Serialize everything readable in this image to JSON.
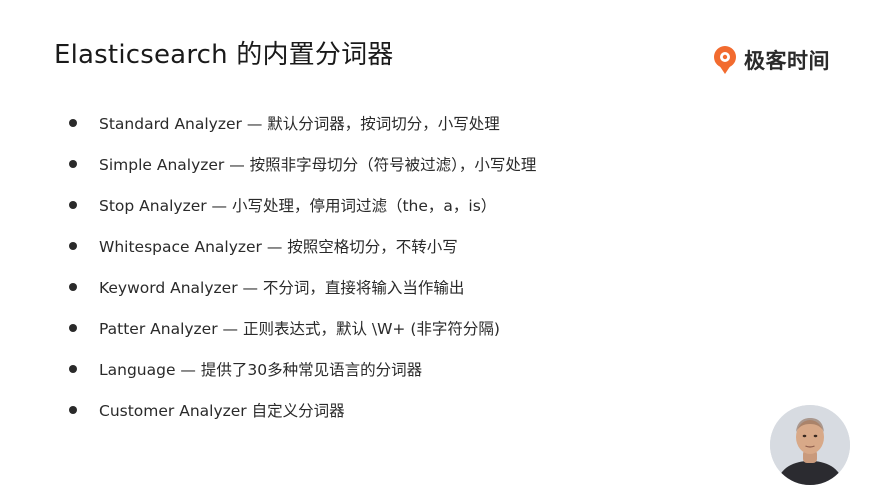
{
  "slide": {
    "title": "Elasticsearch 的内置分词器",
    "logo": {
      "text": "极客时间",
      "brand_color": "#f26b2f",
      "icon": "geektime-logo-icon"
    },
    "bullets": [
      "Standard Analyzer — 默认分词器，按词切分，小写处理",
      "Simple Analyzer — 按照非字母切分（符号被过滤），小写处理",
      "Stop Analyzer — 小写处理，停用词过滤（the，a，is）",
      "Whitespace Analyzer — 按照空格切分，不转小写",
      "Keyword Analyzer — 不分词，直接将输入当作输出",
      "Patter Analyzer — 正则表达式，默认 \\W+ (非字符分隔)",
      "Language — 提供了30多种常见语言的分词器",
      "Customer Analyzer 自定义分词器"
    ],
    "presenter": {
      "icon": "presenter-avatar"
    }
  }
}
